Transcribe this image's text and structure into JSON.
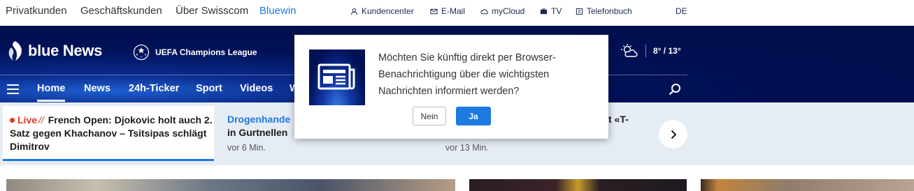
{
  "top_segments": [
    "Privatkunden",
    "Geschäftskunden",
    "Über Swisscom",
    "Bluewin"
  ],
  "services": [
    {
      "label": "Kundencenter",
      "icon": "user-icon"
    },
    {
      "label": "E-Mail",
      "icon": "mail-icon"
    },
    {
      "label": "myCloud",
      "icon": "cloud-icon"
    },
    {
      "label": "TV",
      "icon": "tv-icon"
    },
    {
      "label": "Telefonbuch",
      "icon": "phonebook-icon"
    }
  ],
  "language": "DE",
  "brand": {
    "name": "blue News"
  },
  "ucl_label": "UEFA Champions League",
  "weather": {
    "temps": "8° / 13°",
    "icon": "partly-cloudy-icon"
  },
  "nav": [
    "Home",
    "News",
    "24h-Ticker",
    "Sport",
    "Videos",
    "W"
  ],
  "ticker": {
    "live": {
      "live_label": "Live",
      "slash": "//",
      "text": "French Open: Djokovic holt auch 2. Satz gegen Khachanov – Tsitsipas schlägt Dimitrov"
    },
    "items": [
      {
        "title_line1": "Drogenhande",
        "title_line2": "in Gurtnellen",
        "time": "vor 6 Min."
      },
      {
        "title_line1": "t «T-",
        "time": "vor 13 Min."
      }
    ]
  },
  "dialog": {
    "message": "Möchten Sie künftig direkt per Browser-Benachrichtigung über die wichtigsten Nachrichten informiert werden?",
    "no_label": "Nein",
    "yes_label": "Ja"
  },
  "colors": {
    "accent": "#1d7ae0",
    "navy": "#001156",
    "live": "#e03a1e",
    "ticker_bg": "#e5ecf3"
  }
}
